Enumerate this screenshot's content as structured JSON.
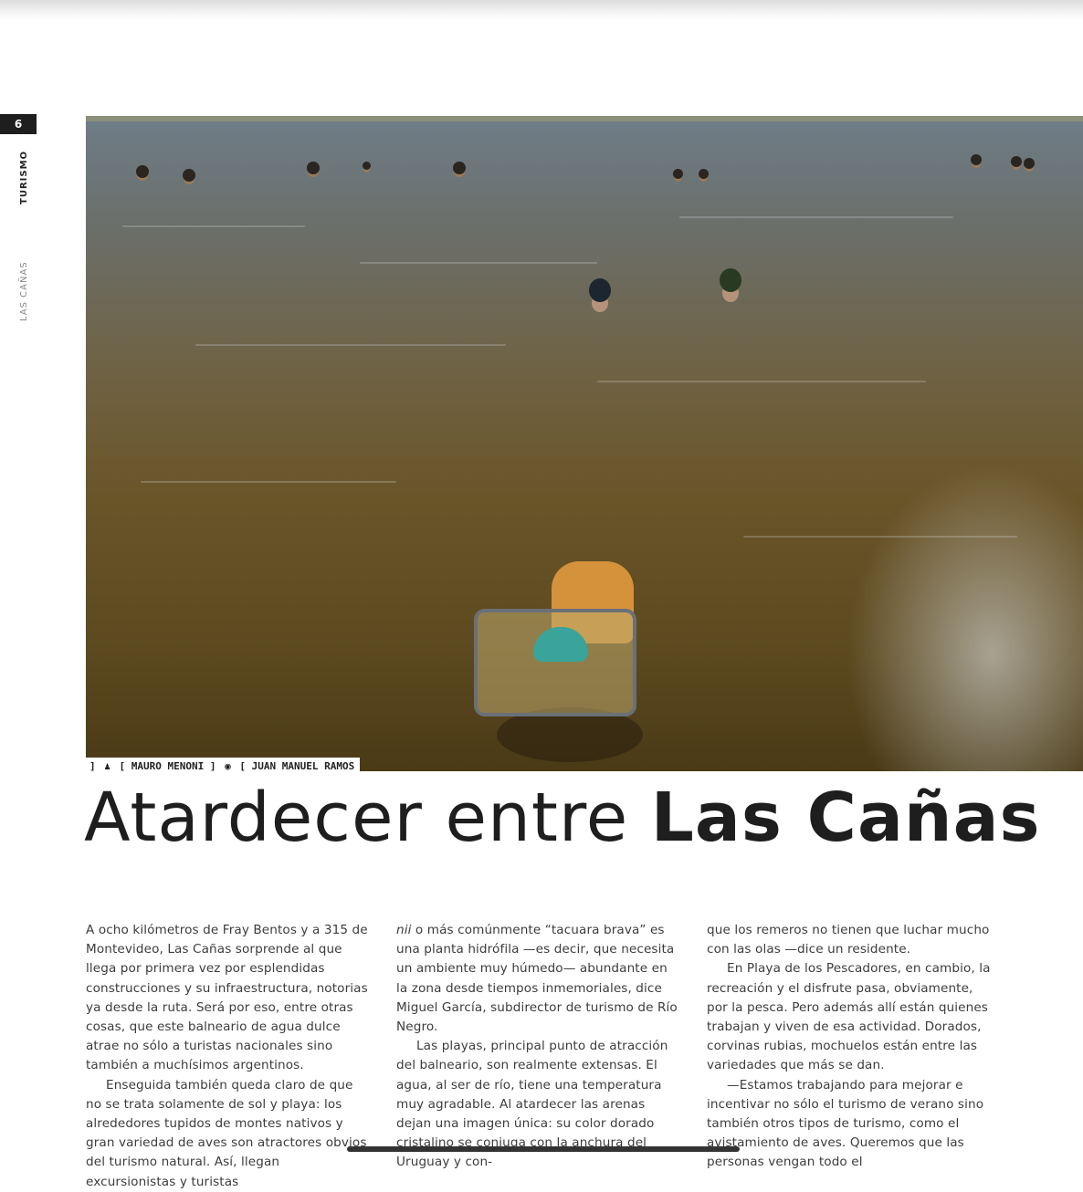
{
  "page": {
    "number": "6",
    "section": "TURISMO",
    "place": "LAS CAÑAS"
  },
  "photo": {
    "credit_writer": "MAURO MENONI",
    "credit_photo": "JUAN MANUEL RAMOS",
    "writer_icon": "pen-person-icon",
    "photo_icon": "eye-icon"
  },
  "headline": {
    "light": "Atardecer entre ",
    "bold": "Las Cañas"
  },
  "columns": [
    {
      "paragraphs": [
        "A ocho kilómetros de Fray Bentos y a 315 de Montevideo, Las Cañas sorprende al que llega por primera vez por esplendidas construcciones y su infraestructura, notorias ya desde la ruta. Será por eso, entre otras cosas, que este balneario de agua dulce atrae no sólo a turistas nacionales sino también a muchísimos argentinos.",
        "Enseguida también queda claro de que no se trata solamente de sol y playa: los alrededores tupidos de montes nativos y gran variedad de aves son atractores obvios del turismo natural. Así, llegan excursionistas y turistas"
      ]
    },
    {
      "lead_italic": "nii",
      "paragraphs": [
        " o más comúnmente “tacuara brava” es una planta hidrófila —es decir, que necesita un ambiente muy húmedo— abundante en la zona desde tiempos inmemoriales, dice Miguel García, subdirector de turismo de Río Negro.",
        "Las playas, principal punto de atracción del balneario, son realmente extensas. El agua, al ser de río, tiene una temperatura muy agradable. Al atardecer las arenas dejan una imagen única: su color dorado cristalino se conjuga con la anchura del Uruguay y con-"
      ]
    },
    {
      "paragraphs": [
        "que los remeros no tienen que luchar mucho con las olas —dice un residente.",
        "En Playa de los Pescadores, en cambio, la recreación y el disfrute pasa, obviamente, por la pesca. Pero además allí están quienes trabajan y viven de esa actividad. Dorados, corvinas rubias, mochuelos están entre las variedades que más se dan.",
        "—Estamos trabajando para mejorar e incentivar no sólo el turismo de verano sino también otros tipos de turismo, como el avistamiento de aves. Queremos que las personas vengan todo el"
      ]
    }
  ],
  "colors": {
    "ink": "#1e1e1e",
    "body_text": "#3c3c3c",
    "water": "#6a5529"
  }
}
